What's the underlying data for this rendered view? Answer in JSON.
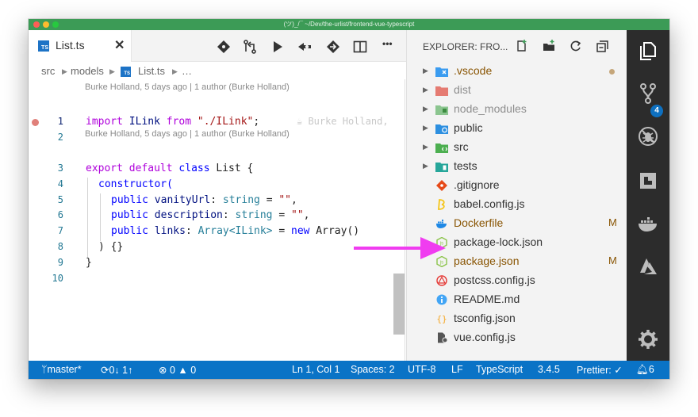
{
  "window": {
    "title": "(ツ)_/¯ ~/Dev/the-urlist/frontend-vue-typescript"
  },
  "editor": {
    "tab": {
      "label": "List.ts",
      "icon_text": "TS",
      "close": "✕"
    },
    "toolbar_icons": [
      "git-diamond-icon",
      "compare-changes-icon",
      "run-icon",
      "go-back-icon",
      "go-forward-icon",
      "split-editor-icon",
      "more-icon"
    ],
    "more_label": "•••",
    "breadcrumb": [
      "src",
      "models",
      "List.ts",
      "…"
    ],
    "codelens": [
      "Burke Holland, 5 days ago | 1 author (Burke Holland)",
      "Burke Holland, 5 days ago | 1 author (Burke Holland)"
    ],
    "line_numbers": [
      "1",
      "2",
      "3",
      "4",
      "5",
      "6",
      "7",
      "8",
      "9",
      "10"
    ],
    "inline_blame": "☕ Burke Holland,",
    "code": {
      "l1": {
        "kw1": "import",
        "name": " ILink ",
        "kw2": "from",
        "str": " \"./ILink\"",
        "end": ";"
      },
      "l3": {
        "kw1": "export",
        "kw2": " default",
        "kw3": " class",
        "name": " List {"
      },
      "l4": {
        "text": "constructor("
      },
      "l5": {
        "kw": "public",
        "var": " vanityUrl",
        "colon": ":",
        "type": " string",
        "eq": " = ",
        "str": "\"\"",
        "end": ","
      },
      "l6": {
        "kw": "public",
        "var": " description",
        "colon": ":",
        "type": " string",
        "eq": " = ",
        "str": "\"\"",
        "end": ","
      },
      "l7": {
        "kw": "public",
        "var": " links",
        "colon": ":",
        "type": " Array<ILink>",
        "eq": " = ",
        "new": "new",
        "rest": " Array()"
      },
      "l8": {
        "text": ") {}"
      },
      "l9": {
        "text": "}"
      }
    }
  },
  "explorer": {
    "title": "EXPLORER: FRO...",
    "tools": [
      "new-file-icon",
      "new-folder-icon",
      "refresh-icon",
      "collapse-all-icon"
    ],
    "items": [
      {
        "name": ".vscode",
        "folder": true,
        "status": "dot",
        "style": "mod"
      },
      {
        "name": "dist",
        "folder": true,
        "status": "",
        "style": "dim"
      },
      {
        "name": "node_modules",
        "folder": true,
        "status": "",
        "style": "dim"
      },
      {
        "name": "public",
        "folder": true,
        "status": "",
        "style": ""
      },
      {
        "name": "src",
        "folder": true,
        "status": "",
        "style": ""
      },
      {
        "name": "tests",
        "folder": true,
        "status": "",
        "style": ""
      },
      {
        "name": ".gitignore",
        "folder": false,
        "status": "",
        "style": ""
      },
      {
        "name": "babel.config.js",
        "folder": false,
        "status": "",
        "style": ""
      },
      {
        "name": "Dockerfile",
        "folder": false,
        "status": "M",
        "style": "mod"
      },
      {
        "name": "package-lock.json",
        "folder": false,
        "status": "",
        "style": ""
      },
      {
        "name": "package.json",
        "folder": false,
        "status": "M",
        "style": "mod"
      },
      {
        "name": "postcss.config.js",
        "folder": false,
        "status": "",
        "style": ""
      },
      {
        "name": "README.md",
        "folder": false,
        "status": "",
        "style": ""
      },
      {
        "name": "tsconfig.json",
        "folder": false,
        "status": "",
        "style": ""
      },
      {
        "name": "vue.config.js",
        "folder": false,
        "status": "",
        "style": ""
      }
    ]
  },
  "activity": {
    "icons": [
      "explorer-icon",
      "source-control-icon",
      "debug-icon",
      "extensions-icon",
      "docker-icon",
      "azure-icon",
      "settings-icon"
    ],
    "scm_badge": "4"
  },
  "statusbar": {
    "branch": "master*",
    "sync": "0↓ 1↑",
    "errors": "0",
    "warnings": "0",
    "position": "Ln 1, Col 1",
    "spaces": "Spaces: 2",
    "encoding": "UTF-8",
    "eol": "LF",
    "language": "TypeScript",
    "version": "3.4.5",
    "prettier": "Prettier: ✓",
    "notifications": "6"
  },
  "colors": {
    "titlebar": "#3c9b56",
    "statusbar": "#0a73c6",
    "activitybar": "#2c2c2c",
    "annotation_arrow": "#f03cf0"
  }
}
